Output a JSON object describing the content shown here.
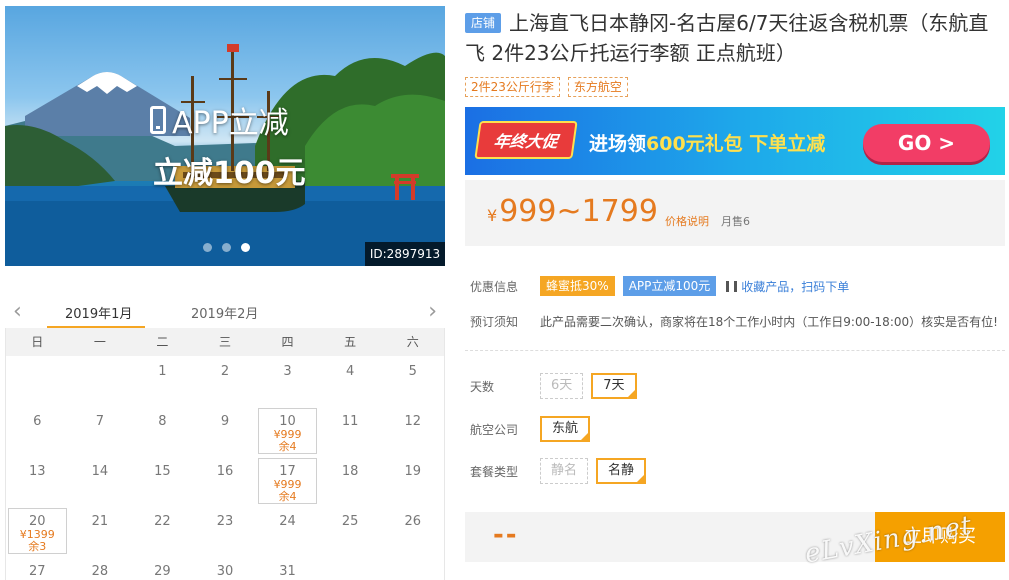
{
  "hero": {
    "promo_line1": "APP立减",
    "promo_line2": "立减100元",
    "id_label": "ID:2897913",
    "slide_count": 3,
    "active_slide": 3
  },
  "calendar": {
    "months": [
      "2019年1月",
      "2019年2月"
    ],
    "active_month": "2019年1月",
    "weekdays": [
      "日",
      "一",
      "二",
      "三",
      "四",
      "五",
      "六"
    ],
    "days": [
      {
        "d": ""
      },
      {
        "d": ""
      },
      {
        "d": "1"
      },
      {
        "d": "2"
      },
      {
        "d": "3"
      },
      {
        "d": "4"
      },
      {
        "d": "5"
      },
      {
        "d": "6"
      },
      {
        "d": "7"
      },
      {
        "d": "8"
      },
      {
        "d": "9"
      },
      {
        "d": "10",
        "price": "¥999",
        "left": "余4"
      },
      {
        "d": "11"
      },
      {
        "d": "12"
      },
      {
        "d": "13"
      },
      {
        "d": "14"
      },
      {
        "d": "15"
      },
      {
        "d": "16"
      },
      {
        "d": "17",
        "price": "¥999",
        "left": "余4"
      },
      {
        "d": "18"
      },
      {
        "d": "19"
      },
      {
        "d": "20",
        "price": "¥1399",
        "left": "余3"
      },
      {
        "d": "21"
      },
      {
        "d": "22"
      },
      {
        "d": "23"
      },
      {
        "d": "24"
      },
      {
        "d": "25"
      },
      {
        "d": "26"
      },
      {
        "d": "27"
      },
      {
        "d": "28"
      },
      {
        "d": "29"
      },
      {
        "d": "30"
      },
      {
        "d": "31"
      },
      {
        "d": ""
      },
      {
        "d": ""
      }
    ]
  },
  "product": {
    "shop_badge": "店铺",
    "title": "上海直飞日本静冈-名古屋6/7天往返含税机票（东航直飞 2件23公斤托运行李额 正点航班）",
    "tags": [
      "2件23公斤行李",
      "东方航空"
    ]
  },
  "ad": {
    "badge": "年终大促",
    "slogan_a": "进场领",
    "slogan_b": "600元礼包",
    "slogan_c": " 下单立减",
    "go": "GO >"
  },
  "price": {
    "currency": "¥",
    "range": "999~1799",
    "note": "价格说明",
    "sold": "月售6"
  },
  "promo": {
    "label": "优惠信息",
    "badge1": "蜂蜜抵30%",
    "badge2": "APP立减100元",
    "fav": "收藏产品，扫码下单"
  },
  "notice": {
    "label": "预订须知",
    "text": "此产品需要二次确认，商家将在18个工作小时内（工作日9:00-18:00）核实是否有位!"
  },
  "options": {
    "days": {
      "label": "天数",
      "items": [
        "6天",
        "7天"
      ],
      "selected": "7天"
    },
    "airline": {
      "label": "航空公司",
      "items": [
        "东航"
      ],
      "selected": "东航"
    },
    "package": {
      "label": "套餐类型",
      "items": [
        "静名",
        "名静"
      ],
      "selected": "名静"
    }
  },
  "buy": {
    "total": "--",
    "button": "立即购买"
  },
  "watermark": "eLvXing.net",
  "colors": {
    "accent": "#f5a623",
    "price": "#e57a1f",
    "blue_badge": "#5d9ee8",
    "buy_button": "#f5a000"
  }
}
